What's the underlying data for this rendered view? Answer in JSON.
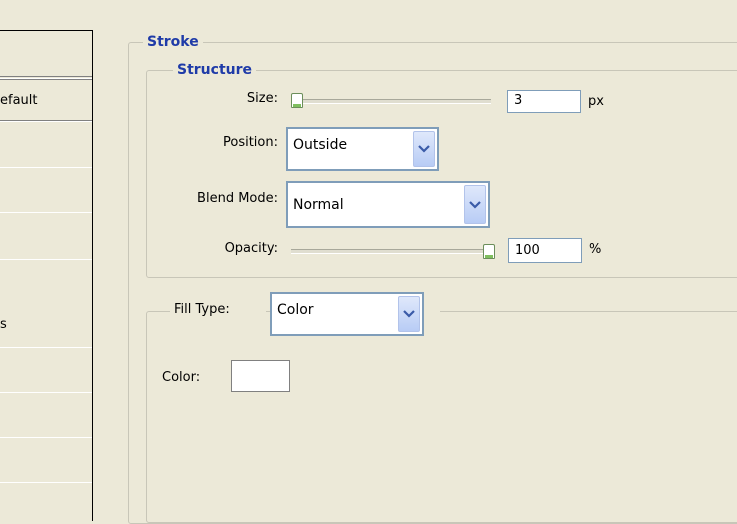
{
  "styles_list": {
    "items": [
      "efault",
      "s"
    ]
  },
  "stroke": {
    "title": "Stroke",
    "structure": {
      "title": "Structure",
      "size": {
        "label": "Size:",
        "value": "3",
        "unit": "px",
        "level": 0.0
      },
      "position": {
        "label": "Position:",
        "value": "Outside"
      },
      "blend_mode": {
        "label": "Blend Mode:",
        "value": "Normal"
      },
      "opacity": {
        "label": "Opacity:",
        "value": "100",
        "unit": "%",
        "level": 1.0
      }
    },
    "fill": {
      "type_label": "Fill Type:",
      "type_value": "Color",
      "color_label": "Color:",
      "color_value": "#ffffff"
    }
  },
  "icons": {
    "dropdown": "chevron-down-icon",
    "slider_thumb": "slider-thumb-icon"
  }
}
